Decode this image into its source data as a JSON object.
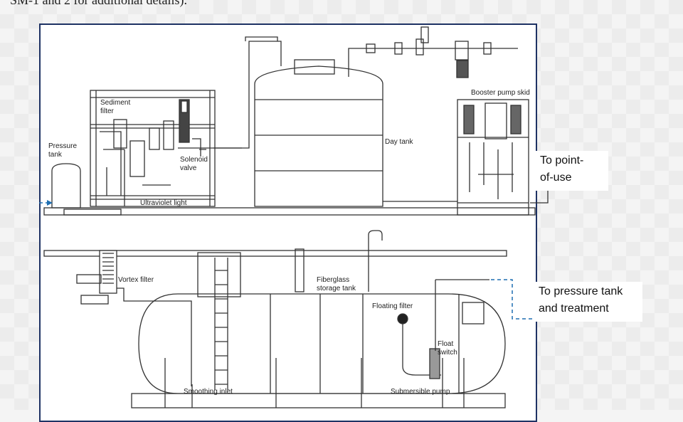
{
  "caption": "SM-1 and 2 for additional details).",
  "labels": {
    "sediment_filter": "Sediment\nfilter",
    "pressure_tank": "Pressure\ntank",
    "solenoid_valve": "Solenoid\nvalve",
    "ultraviolet_light": "Ultraviolet light",
    "day_tank": "Day tank",
    "booster_pump_skid": "Booster pump skid",
    "vortex_filter": "Vortex filter",
    "fiberglass_storage_tank": "Fiberglass\nstorage tank",
    "floating_filter": "Floating filter",
    "float_switch": "Float\nswitch",
    "smoothing_inlet": "Smoothing inlet",
    "submersible_pump": "Submersible pump"
  },
  "callouts": {
    "point_of_use": "To point-\nof-use",
    "pressure_tank_treatment": "To pressure tank\nand treatment"
  },
  "colors": {
    "frame": "#1e3264",
    "arrow": "#1f6fb2",
    "line": "#333333"
  }
}
